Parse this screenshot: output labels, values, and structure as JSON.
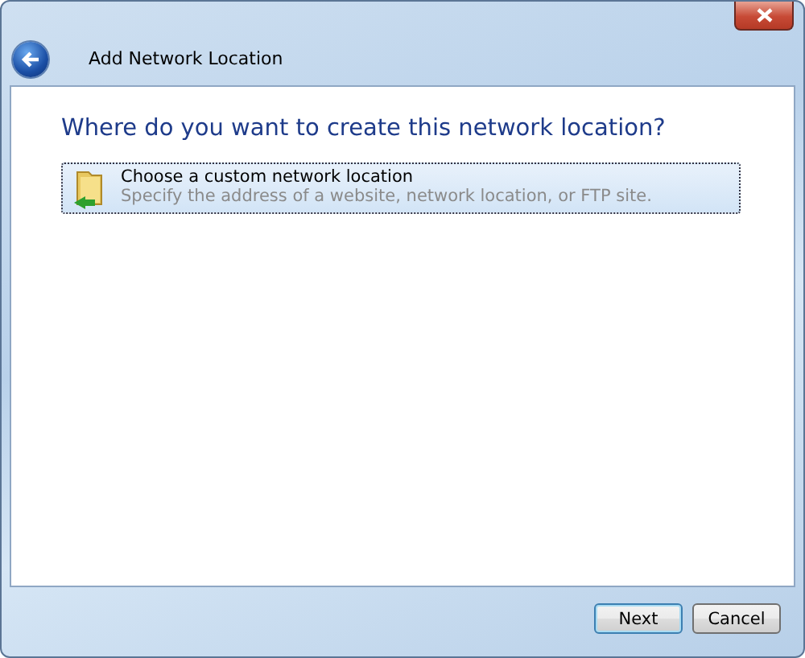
{
  "window": {
    "title": "Add Network Location"
  },
  "heading": "Where do you want to create this network location?",
  "options": [
    {
      "title": "Choose a custom network location",
      "description": "Specify the address of a website, network location, or FTP site.",
      "selected": true
    }
  ],
  "buttons": [
    {
      "label": "Next",
      "default": true
    },
    {
      "label": "Cancel",
      "default": false
    }
  ]
}
